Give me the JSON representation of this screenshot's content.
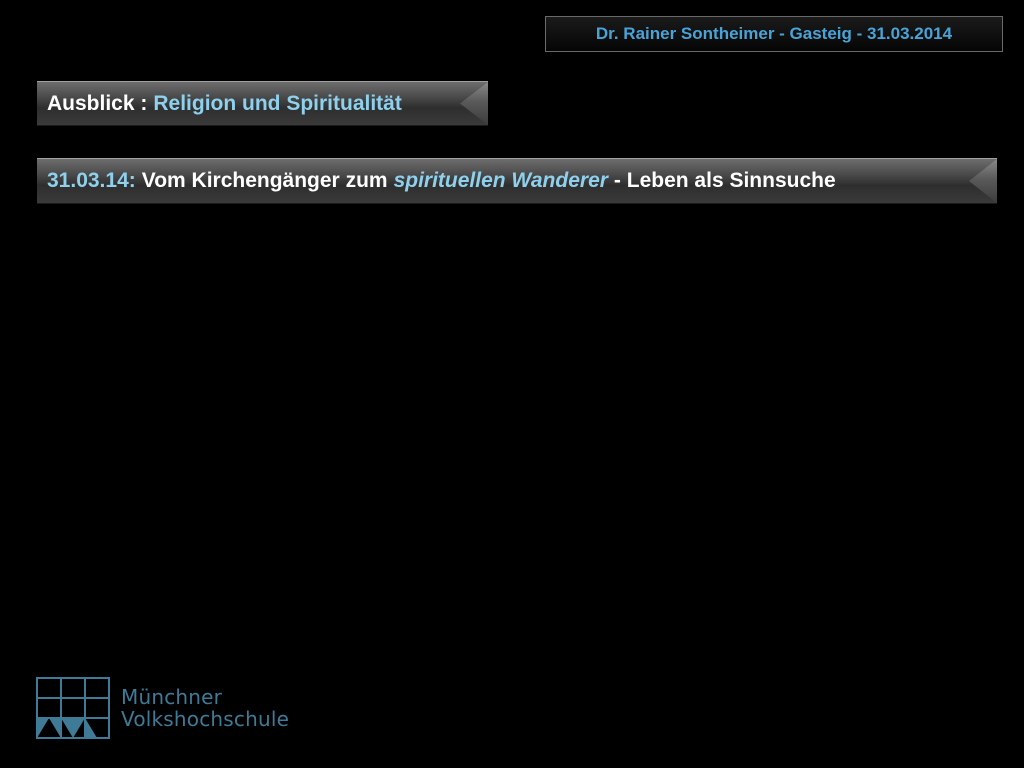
{
  "header": {
    "text": "Dr. Rainer Sontheimer - Gasteig - 31.03.2014"
  },
  "topic_bar": {
    "prefix": "Ausblick : ",
    "topic": "Religion und Spiritualität"
  },
  "session_bar": {
    "date": "31.03.14:",
    "text_before": " Vom Kirchengänger zum ",
    "highlight": "spirituellen Wanderer",
    "text_after": " - Leben als Sinnsuche"
  },
  "logo": {
    "line1": "Münchner",
    "line2": "Volkshochschule",
    "icon": "mvhs-grid-logo-icon"
  },
  "colors": {
    "background": "#000000",
    "accent_blue": "#8fd0ec",
    "header_text": "#4aa3d6",
    "logo_color": "#3f7a96"
  }
}
